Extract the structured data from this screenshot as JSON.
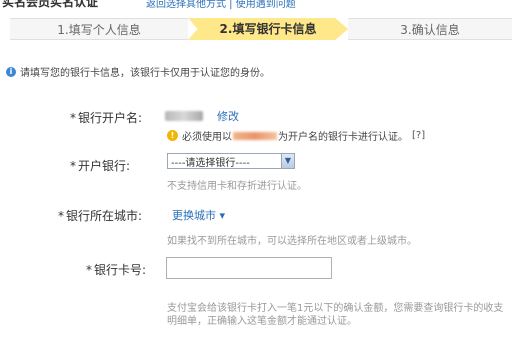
{
  "header": {
    "title": "实名会员实名认证",
    "links": "返回选择其他方式 | 使用遇到问题"
  },
  "steps": [
    {
      "label": "1.填写个人信息"
    },
    {
      "label": "2.填写银行卡信息"
    },
    {
      "label": "3.确认信息"
    }
  ],
  "notice": {
    "text": "请填写您的银行卡信息，该银行卡仅用于认证您的身份。"
  },
  "fields": {
    "account_name": {
      "label": "银行开户名:",
      "modify_link": "修改",
      "warning_prefix": "必须使用以",
      "warning_suffix": "为开户名的银行卡进行认证。",
      "help": "[?]"
    },
    "bank": {
      "label": "开户银行:",
      "selected": "----请选择银行----",
      "hint": "不支持信用卡和存折进行认证。"
    },
    "city": {
      "label": "银行所在城市:",
      "link": "更换城市",
      "hint": "如果找不到所在城市，可以选择所在地区或者上级城市。"
    },
    "card_number": {
      "label": "银行卡号:",
      "value": "",
      "hint": "支付宝会给该银行卡打入一笔1元以下的确认金额，您需要查询银行卡的收支明细单，正确输入这笔金额才能通过认证。"
    }
  },
  "colors": {
    "active_step": "#ffe88a",
    "link": "#2a6fb7",
    "hint": "#999999"
  }
}
